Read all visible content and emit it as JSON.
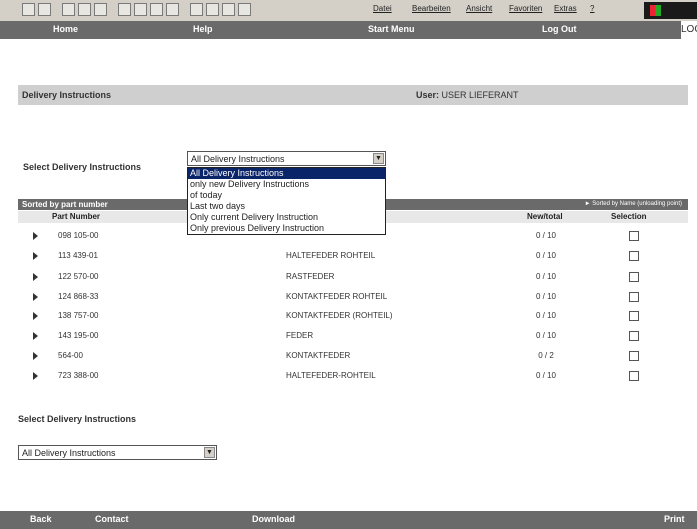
{
  "toolbar": {
    "menus": [
      "Datei",
      "Bearbeiten",
      "Ansicht",
      "Favoriten",
      "Extras",
      "?"
    ]
  },
  "nav": {
    "home": "Home",
    "help": "Help",
    "start_menu": "Start Menu",
    "logout": "Log Out",
    "logo": "LOG"
  },
  "header": {
    "title": "Delivery Instructions",
    "user_label": "User:",
    "user_value": "USER LIEFERANT"
  },
  "top_select": {
    "label": "Select Delivery Instructions",
    "value": "All Delivery Instructions",
    "options": [
      "All Delivery Instructions",
      "only new Delivery Instructions",
      "of today",
      "Last two days",
      "Only current Delivery Instruction",
      "Only previous Delivery Instruction"
    ],
    "selected_index": 0
  },
  "table": {
    "sort_label": "Sorted by part number",
    "sort_alt": "Sorted by Name (unloading point)",
    "col_part": "Part Number",
    "col_newtotal": "New/total",
    "col_selection": "Selection",
    "rows": [
      {
        "part": "098 105-00",
        "desc": "",
        "nt": "0 / 10"
      },
      {
        "part": "113 439-01",
        "desc": "HALTEFEDER ROHTEIL",
        "nt": "0 / 10"
      },
      {
        "part": "122 570-00",
        "desc": "RASTFEDER",
        "nt": "0 / 10"
      },
      {
        "part": "124 868-33",
        "desc": "KONTAKTFEDER ROHTEIL",
        "nt": "0 / 10"
      },
      {
        "part": "138 757-00",
        "desc": "KONTAKTFEDER (ROHTEIL)",
        "nt": "0 / 10"
      },
      {
        "part": "143 195-00",
        "desc": "FEDER",
        "nt": "0 / 10"
      },
      {
        "part": "564-00",
        "desc": "KONTAKTFEDER",
        "nt": "0 / 2"
      },
      {
        "part": "723 388-00",
        "desc": "HALTEFEDER-ROHTEIL",
        "nt": "0 / 10"
      }
    ]
  },
  "bottom_select": {
    "label": "Select Delivery Instructions",
    "value": "All Delivery Instructions"
  },
  "footer": {
    "back": "Back",
    "contact": "Contact",
    "download": "Download",
    "print": "Print"
  },
  "colors": {
    "bar": "#6a6a6a",
    "strip": "#cfcfcf",
    "highlight": "#0a246a"
  }
}
